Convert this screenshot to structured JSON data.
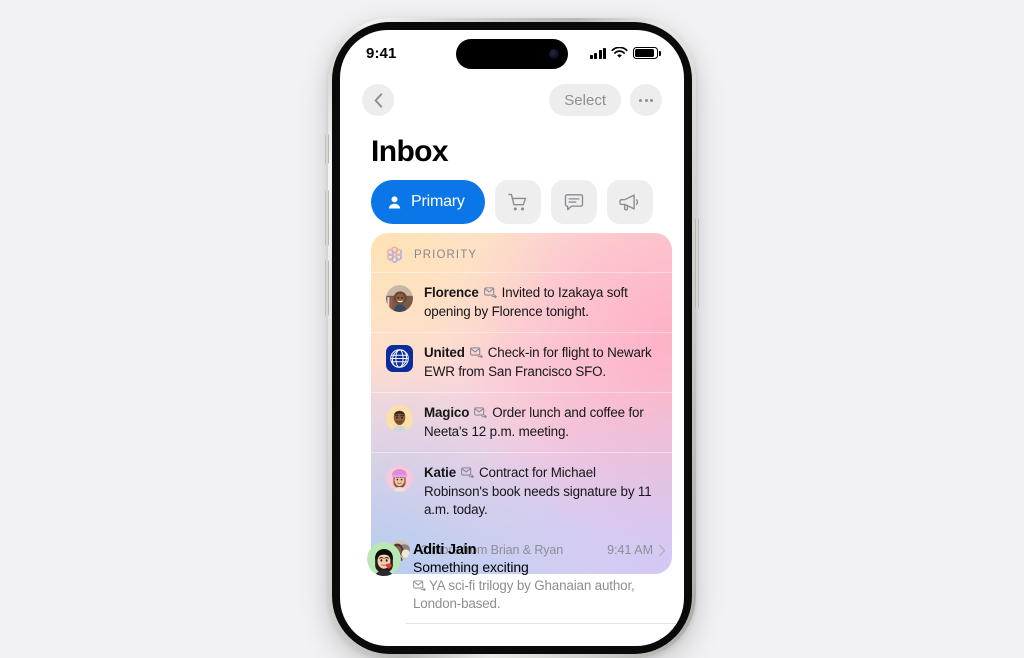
{
  "statusbar": {
    "time": "9:41",
    "signal_icon": "cellular-bars-icon",
    "wifi_icon": "wifi-icon",
    "battery_icon": "battery-full-icon"
  },
  "nav": {
    "back_icon": "chevron-left-icon",
    "select_label": "Select",
    "more_icon": "ellipsis-icon"
  },
  "page_title": "Inbox",
  "tabs": [
    {
      "id": "primary",
      "label": "Primary",
      "icon": "person-icon",
      "active": true
    },
    {
      "id": "transactions",
      "label": "",
      "icon": "cart-icon",
      "active": false
    },
    {
      "id": "updates",
      "label": "",
      "icon": "chat-bubble-icon",
      "active": false
    },
    {
      "id": "promotions",
      "label": "",
      "icon": "megaphone-icon",
      "active": false
    }
  ],
  "priority": {
    "icon": "apple-intelligence-icon",
    "label": "PRIORITY",
    "items": [
      {
        "sender": "Florence",
        "badge_icon": "mail-forward-icon",
        "summary": "Invited to Izakaya soft opening by Florence tonight.",
        "avatar": "photo-woman-avatar"
      },
      {
        "sender": "United",
        "badge_icon": "mail-forward-icon",
        "summary": "Check-in for flight to Newark EWR from San Francisco SFO.",
        "avatar": "united-airlines-logo"
      },
      {
        "sender": "Magico",
        "badge_icon": "mail-forward-icon",
        "summary": "Order lunch and coffee for Neeta's 12 p.m. meeting.",
        "avatar": "memoji-man-avatar"
      },
      {
        "sender": "Katie",
        "badge_icon": "mail-forward-icon",
        "summary": "Contract for Michael Robinson's book needs signature by 11 a.m. today.",
        "avatar": "memoji-woman-beanie-avatar"
      }
    ],
    "more_text": "2 more from Brian & Ryan",
    "more_avatar": "stacked-avatars"
  },
  "messages": [
    {
      "from": "Aditi Jain",
      "time": "9:41 AM",
      "chevron_icon": "chevron-right-icon",
      "subject": "Something exciting",
      "badge_icon": "mail-forward-icon",
      "preview": "YA sci-fi trilogy by Ghanaian author, London-based.",
      "avatar": "memoji-woman-green-avatar"
    }
  ],
  "colors": {
    "accent_blue": "#0a76e8",
    "page_background": "#f2f2f4",
    "secondary_text": "#8e8e93",
    "chip_background": "#eeeeef"
  }
}
